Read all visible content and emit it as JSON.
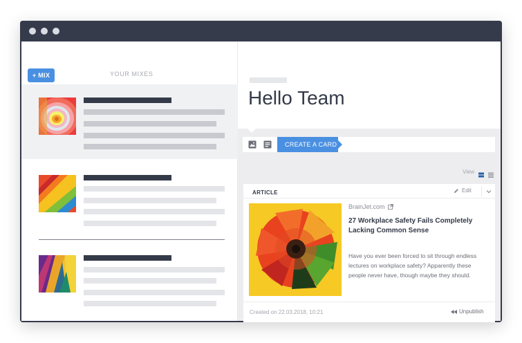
{
  "sidebar": {
    "add_mix_label": "+ MIX",
    "title": "YOUR MIXES"
  },
  "main": {
    "title": "Hello Team",
    "toolbar": {
      "create_card_label": "CREATE A CARD"
    },
    "view_label": "View"
  },
  "card": {
    "type_label": "ARTICLE",
    "edit_label": "Edit",
    "source": "BrainJet.com",
    "headline": "27 Workplace Safety Fails Completely Lacking Common Sense",
    "excerpt": "Have you ever been forced to sit through endless lectures on workplace safety? Apparently these people never have, though maybe they should.",
    "created": "Created on 22.03.2018, 10:21",
    "unpublish_label": "Unpublish"
  },
  "colors": {
    "accent": "#4a90e2",
    "window_frame": "#353b4b",
    "text_dark": "#343a48"
  },
  "icons": {
    "image": "image-icon",
    "text": "text-icon",
    "grid": "grid-view-icon",
    "list": "list-view-icon",
    "edit": "pencil-icon",
    "external": "external-link-icon",
    "chevron": "chevron-down-icon",
    "unpublish": "rewind-icon"
  }
}
